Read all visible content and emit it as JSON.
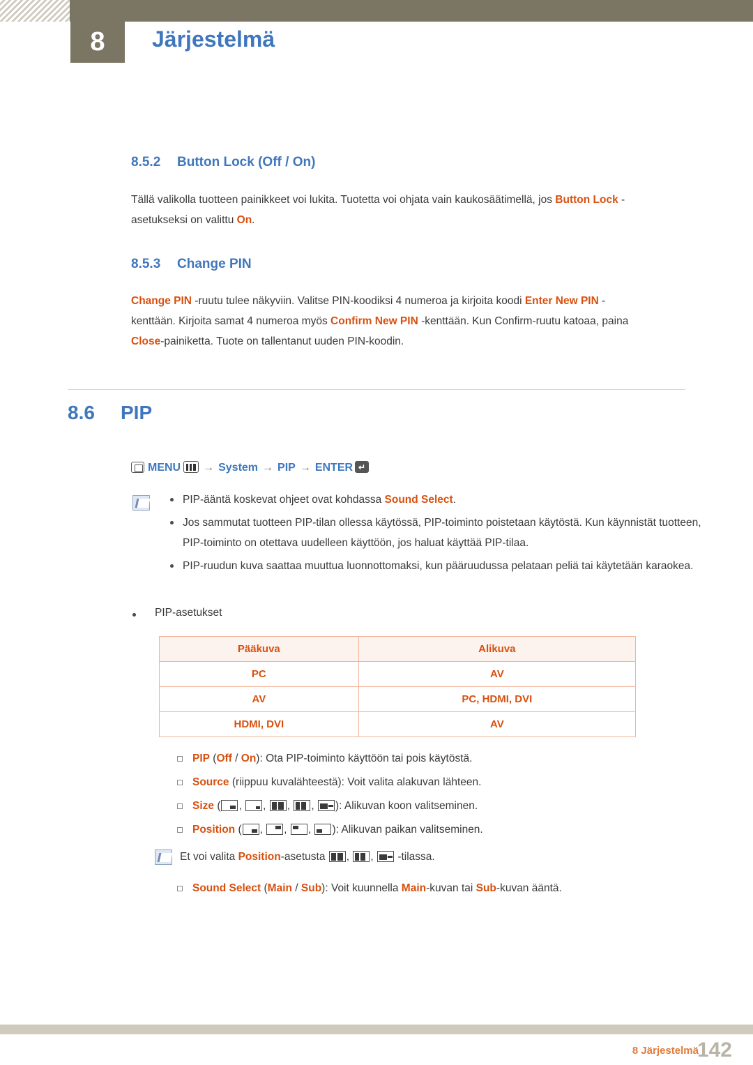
{
  "header": {
    "chapter_number": "8",
    "chapter_title": "Järjestelmä"
  },
  "sections": {
    "s852": {
      "number": "8.5.2",
      "title": "Button Lock (Off / On)",
      "body_line1_a": "Tällä valikolla tuotteen painikkeet voi lukita. Tuotetta voi ohjata vain kaukosäätimellä, jos ",
      "body_line1_kw": "Button Lock",
      "body_line1_b": " -",
      "body_line2_a": "asetukseksi on valittu ",
      "body_line2_kw": "On",
      "body_line2_b": "."
    },
    "s853": {
      "number": "8.5.3",
      "title": "Change PIN",
      "l1_kw": "Change PIN",
      "l1_a": " -ruutu tulee näkyviin. Valitse PIN-koodiksi 4 numeroa ja kirjoita koodi ",
      "l1_kw2": "Enter New PIN",
      "l1_b": " -",
      "l2_a": "kenttään. Kirjoita samat 4 numeroa myös ",
      "l2_kw": "Confirm New PIN",
      "l2_b": " -kenttään. Kun Confirm-ruutu katoaa, paina",
      "l3_kw": "Close",
      "l3_a": "-painiketta. Tuote on tallentanut uuden PIN-koodin."
    },
    "s86": {
      "number": "8.6",
      "title": "PIP",
      "menu_path": {
        "menu_label": "MENU",
        "arrow": "→",
        "system": "System",
        "pip": "PIP",
        "enter": "ENTER",
        "enter_glyph": "↵",
        "menu_icon": "menu-icon",
        "bars_icon": "pip-bars-icon"
      },
      "notes": [
        {
          "a": "PIP-ääntä koskevat ohjeet ovat kohdassa ",
          "kw": "Sound Select",
          "b": "."
        },
        {
          "a": "Jos sammutat tuotteen PIP-tilan ollessa käytössä, PIP-toiminto poistetaan käytöstä. Kun käynnistät tuotteen, PIP-toiminto on otettava uudelleen käyttöön, jos haluat käyttää PIP-tilaa.",
          "kw": "",
          "b": ""
        },
        {
          "a": "PIP-ruudun kuva saattaa muuttua luonnottomaksi, kun pääruudussa pelataan peliä tai käytetään karaokea.",
          "kw": "",
          "b": ""
        }
      ],
      "settings_bullet": "PIP-asetukset",
      "table": {
        "headers": [
          "Pääkuva",
          "Alikuva"
        ],
        "rows": [
          [
            "PC",
            "AV"
          ],
          [
            "AV",
            "PC, HDMI, DVI"
          ],
          [
            "HDMI, DVI",
            "AV"
          ]
        ]
      },
      "definitions": [
        {
          "kw": "PIP",
          "paren_open": " (",
          "opt1": "Off",
          "slash": " / ",
          "opt2": "On",
          "paren_close": ")",
          "rest": ": Ota PIP-toiminto käyttöön tai pois käytöstä."
        },
        {
          "kw": "Source",
          "rest": " (riippuu kuvalähteestä): Voit valita alakuvan lähteen."
        },
        {
          "kw": "Size",
          "rest": "): Alikuvan koon valitseminen.",
          "icons": [
            "pip-size-icon-1",
            "pip-size-icon-2",
            "pip-size-icon-3",
            "pip-size-icon-4",
            "pip-size-icon-5"
          ]
        },
        {
          "kw": "Position",
          "rest": "): Alikuvan paikan valitseminen.",
          "icons": [
            "pip-position-icon-1",
            "pip-position-icon-2",
            "pip-position-icon-3",
            "pip-position-icon-4"
          ]
        },
        {
          "kw": "Sound Select",
          "paren_open": " (",
          "opt1": "Main",
          "slash": " / ",
          "opt2": "Sub",
          "paren_close": ")",
          "rest": ": Voit kuunnella ",
          "kw2": "Main",
          "rest2": "-kuvan tai ",
          "kw3": "Sub",
          "rest3": "-kuvan ääntä."
        }
      ],
      "inline_note": {
        "a": "Et voi valita ",
        "kw": "Position",
        "b": "-asetusta ",
        "c": " -tilassa.",
        "icons": [
          "pip-size-icon-3",
          "pip-size-icon-4",
          "pip-size-icon-5"
        ]
      }
    }
  },
  "footer": {
    "label": "8 Järjestelmä",
    "page": "142"
  },
  "colors": {
    "accent_blue": "#3f77bd",
    "keyword_orange": "#d8500f",
    "header_olive": "#7b7564",
    "table_border": "#f0b49b",
    "table_header_bg": "#fdf3ee"
  }
}
